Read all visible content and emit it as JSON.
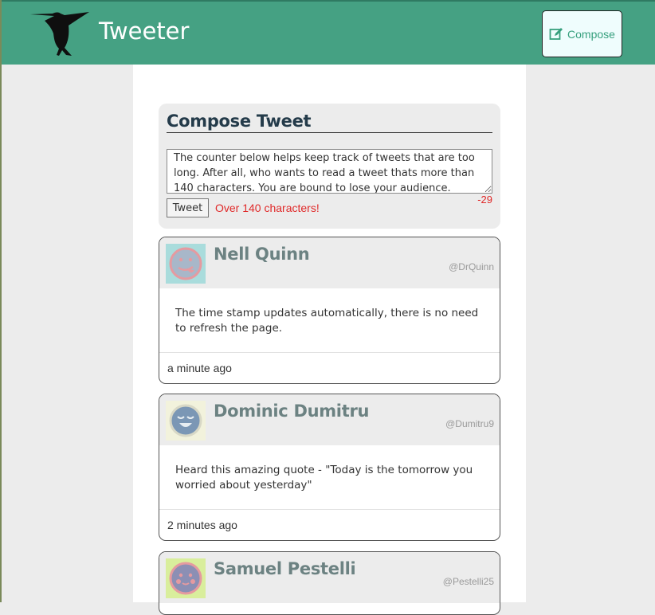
{
  "nav": {
    "brand": "Tweeter",
    "compose_label": "Compose",
    "icons": {
      "logo": "hummingbird-logo",
      "compose": "edit-icon"
    }
  },
  "composer": {
    "title": "Compose Tweet",
    "text": "The counter below helps keep track of tweets that are too long. After all, who wants to read a tweet thats more than 140 characters. You are bound to lose your audience.",
    "button_label": "Tweet",
    "error": "Over 140 characters!",
    "counter": "-29"
  },
  "tweets": [
    {
      "name": "Nell Quinn",
      "handle": "@DrQuinn",
      "text": "The time stamp updates automatically, there is no need to refresh the page.",
      "time": "a minute ago",
      "avatar_icon": "tongue-face-avatar"
    },
    {
      "name": "Dominic Dumitru",
      "handle": "@Dumitru9",
      "text": "Heard this amazing quote - \"Today is the tomorrow you worried about yesterday\"",
      "time": "2 minutes ago",
      "avatar_icon": "happy-face-avatar"
    },
    {
      "name": "Samuel Pestelli",
      "handle": "@Pestelli25",
      "avatar_icon": "blush-face-avatar"
    }
  ],
  "colors": {
    "nav": "#45a183",
    "accent": "#37a07e",
    "error": "#e02a2a",
    "name": "#6c8282"
  }
}
